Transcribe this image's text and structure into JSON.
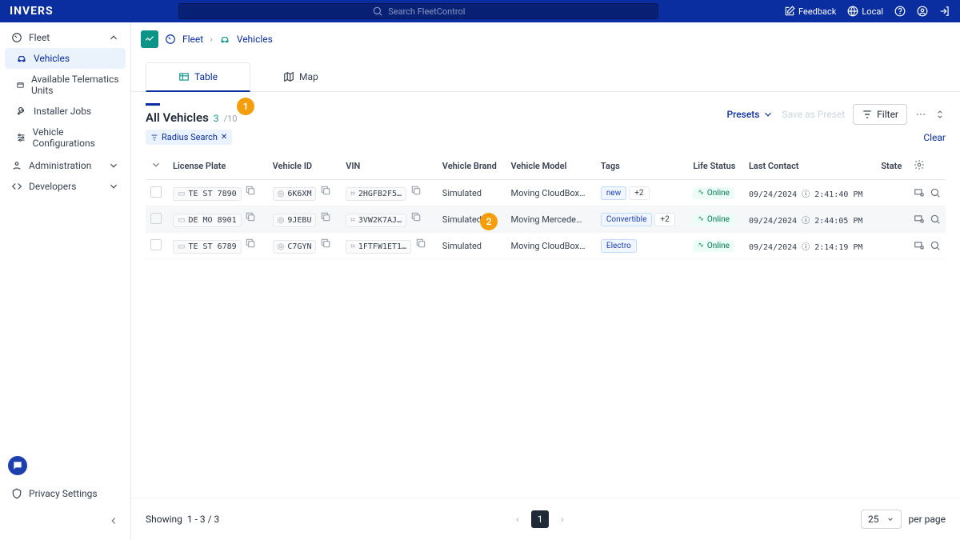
{
  "top": {
    "logo": "INVERS",
    "search_placeholder": "Search FleetControl",
    "feedback": "Feedback",
    "local": "Local"
  },
  "breadcrumb": {
    "fleet": "Fleet",
    "vehicles": "Vehicles"
  },
  "sidebar": {
    "fleet": "Fleet",
    "vehicles": "Vehicles",
    "atu": "Available Telematics Units",
    "installer": "Installer Jobs",
    "vconfig": "Vehicle Configurations",
    "admin": "Administration",
    "dev": "Developers",
    "privacy": "Privacy Settings"
  },
  "tabs": {
    "table": "Table",
    "map": "Map"
  },
  "header": {
    "title": "All Vehicles",
    "count": "3",
    "total": "/10",
    "presets": "Presets",
    "saveas": "Save as Preset",
    "filter": "Filter",
    "clear": "Clear",
    "chip": "Radius Search"
  },
  "table": {
    "cols": {
      "plate": "License Plate",
      "vid": "Vehicle ID",
      "vin": "VIN",
      "brand": "Vehicle Brand",
      "model": "Vehicle Model",
      "tags": "Tags",
      "life": "Life Status",
      "last": "Last Contact",
      "state": "State"
    },
    "rows": [
      {
        "plate": "TE ST 7890",
        "vid": "6K6XM",
        "vin": "2HGFB2F5…",
        "brand": "Simulated",
        "model": "Moving CloudBox…",
        "tags": [
          {
            "t": "new",
            "c": "blue"
          },
          {
            "t": "+2",
            "c": "gray"
          }
        ],
        "life": "Online",
        "last": "09/24/2024 ⓘ 2:41:40 PM"
      },
      {
        "plate": "DE MO 8901",
        "vid": "9JEBU",
        "vin": "3VW2K7AJ…",
        "brand": "Simulated",
        "model": "Moving Mercede…",
        "tags": [
          {
            "t": "Convertible",
            "c": "blue"
          },
          {
            "t": "+2",
            "c": "gray"
          }
        ],
        "life": "Online",
        "last": "09/24/2024 ⓘ 2:44:05 PM",
        "sel": true
      },
      {
        "plate": "TE ST 6789",
        "vid": "C7GYN",
        "vin": "1FTFW1ET1…",
        "brand": "Simulated",
        "model": "Moving CloudBox…",
        "tags": [
          {
            "t": "Electro",
            "c": "blue"
          }
        ],
        "life": "Online",
        "last": "09/24/2024 ⓘ 2:14:19 PM"
      }
    ]
  },
  "pager": {
    "showing": "Showing",
    "range": "1 - 3 / 3",
    "page": "1",
    "perpage": "25",
    "pplabel": "per page"
  },
  "markers": {
    "m1": "1",
    "m2": "2"
  }
}
